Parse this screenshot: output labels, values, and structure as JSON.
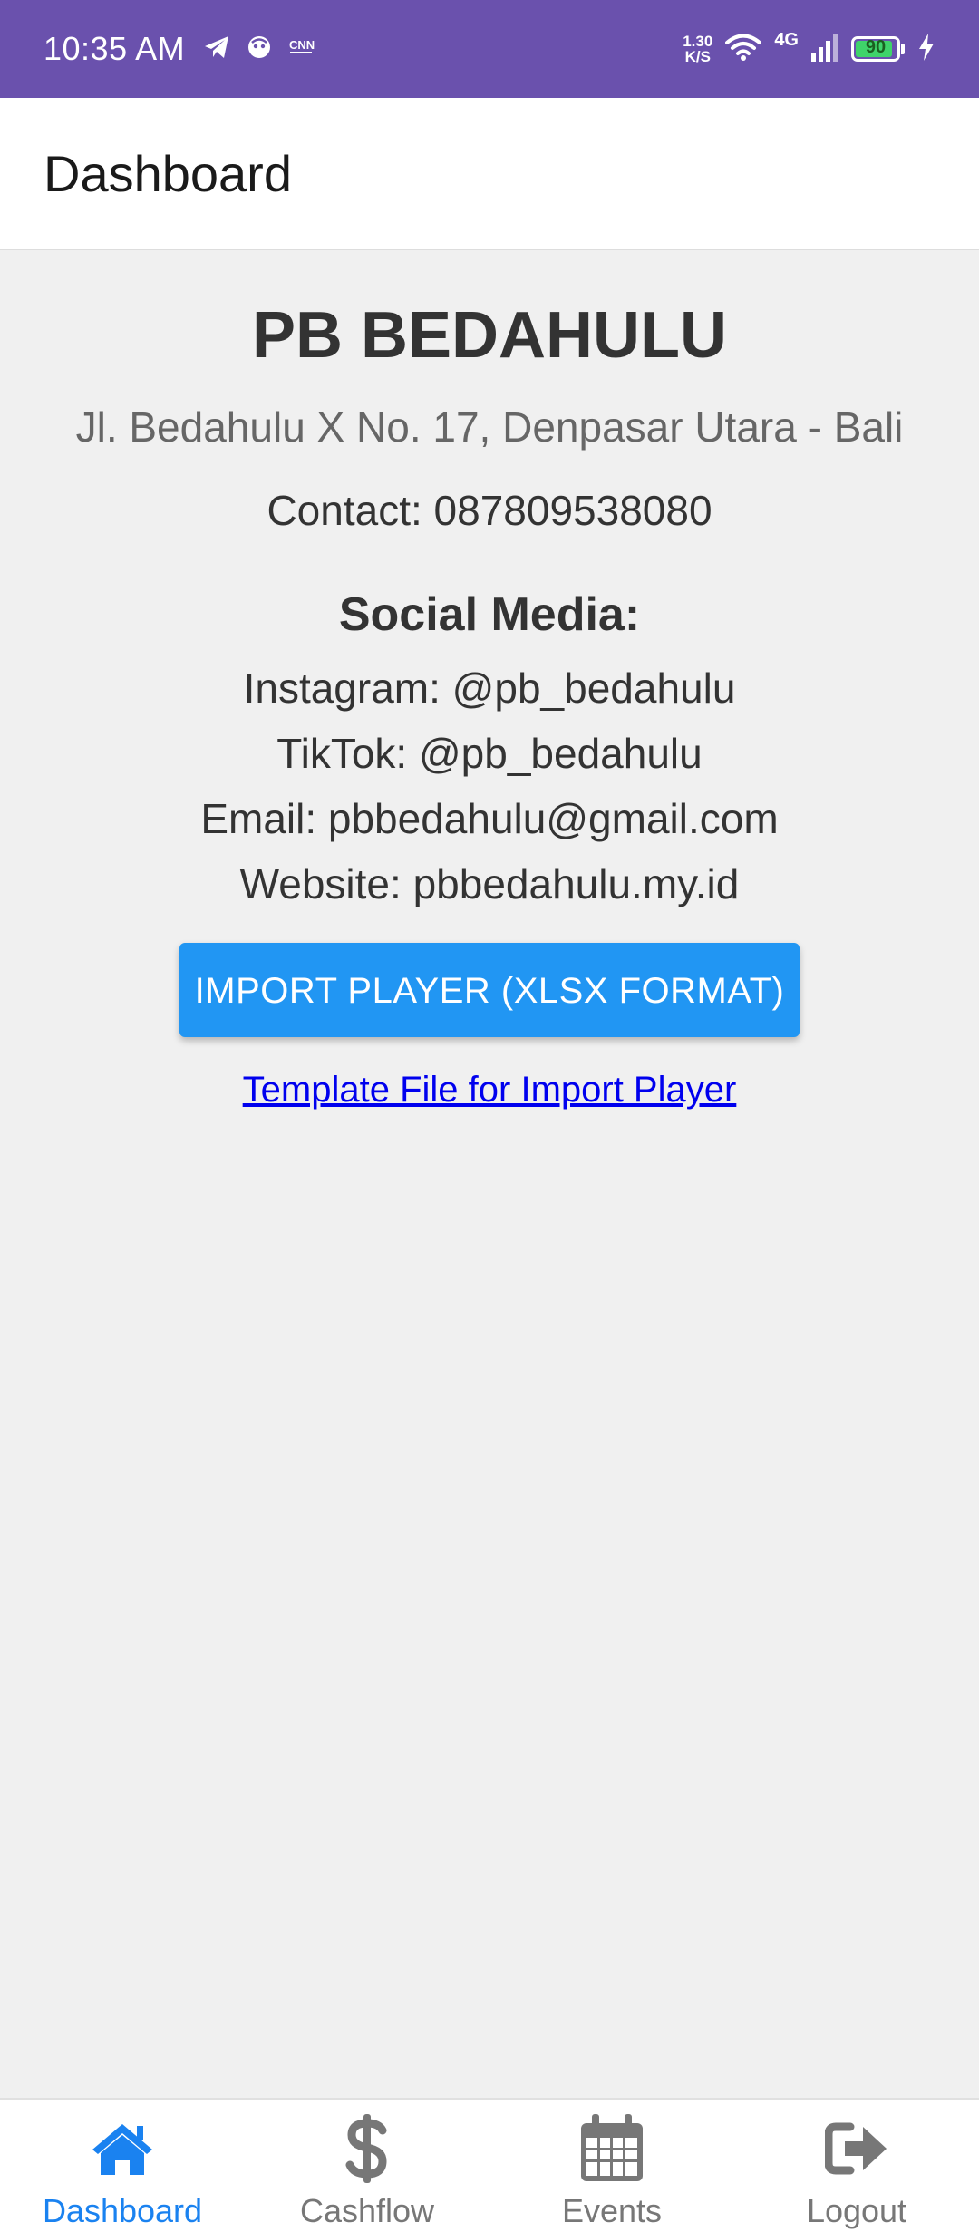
{
  "status_bar": {
    "time": "10:35 AM",
    "net_speed_value": "1.30",
    "net_speed_unit": "K/S",
    "network_type": "4G",
    "battery_level": "90",
    "left_icons": [
      "telegram-icon",
      "notification-face-icon",
      "cnn-icon"
    ],
    "right_icons": [
      "wifi-icon",
      "signal-icon",
      "battery-icon",
      "charging-icon"
    ],
    "bg_color": "#6a51ad"
  },
  "header": {
    "title": "Dashboard"
  },
  "club": {
    "name": "PB BEDAHULU",
    "address": "Jl. Bedahulu X No. 17, Denpasar Utara - Bali",
    "contact": "Contact: 087809538080"
  },
  "social": {
    "heading": "Social Media:",
    "instagram": "Instagram: @pb_bedahulu",
    "tiktok": "TikTok: @pb_bedahulu",
    "email": "Email: pbbedahulu@gmail.com",
    "website": "Website: pbbedahulu.my.id"
  },
  "actions": {
    "import_button": "IMPORT PLAYER (XLSX FORMAT)",
    "template_link": "Template File for Import Player",
    "button_color": "#2196f3"
  },
  "bottom_nav": {
    "items": [
      {
        "label": "Dashboard",
        "icon": "home-icon",
        "active": true
      },
      {
        "label": "Cashflow",
        "icon": "dollar-icon",
        "active": false
      },
      {
        "label": "Events",
        "icon": "calendar-icon",
        "active": false
      },
      {
        "label": "Logout",
        "icon": "logout-icon",
        "active": false
      }
    ],
    "active_color": "#1a82f0",
    "inactive_color": "#777777"
  }
}
